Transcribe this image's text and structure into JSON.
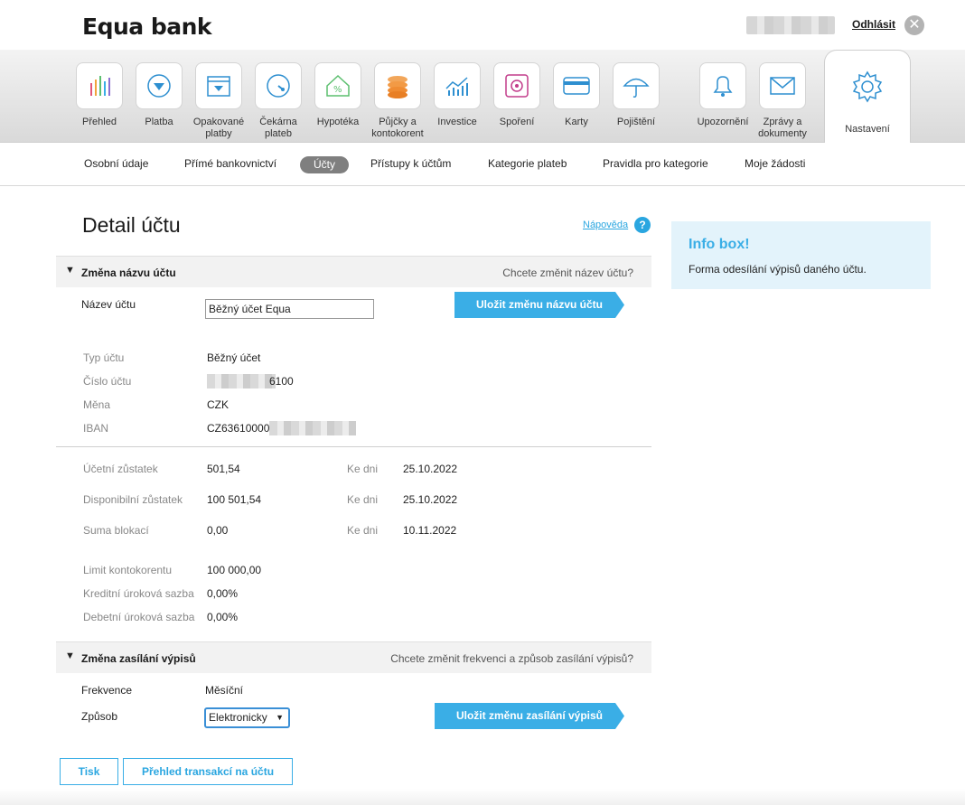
{
  "header": {
    "logo": "Equa bank",
    "logout": "Odhlásit"
  },
  "nav": {
    "items": [
      {
        "label": "Přehled",
        "icon": "chart-bars-icon"
      },
      {
        "label": "Platba",
        "icon": "payment-arrow-icon"
      },
      {
        "label": "Opakované platby",
        "icon": "calendar-icon"
      },
      {
        "label": "Čekárna plateb",
        "icon": "clock-icon"
      },
      {
        "label": "Hypotéka",
        "icon": "house-percent-icon"
      },
      {
        "label": "Půjčky a kontokorent",
        "icon": "coins-icon"
      },
      {
        "label": "Investice",
        "icon": "investment-chart-icon"
      },
      {
        "label": "Spoření",
        "icon": "safe-icon"
      },
      {
        "label": "Karty",
        "icon": "card-icon"
      },
      {
        "label": "Pojištění",
        "icon": "umbrella-icon"
      },
      {
        "label": "Upozornění",
        "icon": "bell-icon"
      },
      {
        "label": "Zprávy a dokumenty",
        "icon": "envelope-icon"
      },
      {
        "label": "Nastavení",
        "icon": "gear-icon",
        "active": true
      }
    ]
  },
  "subnav": {
    "items": [
      "Osobní údaje",
      "Přímé bankovnictví",
      "Účty",
      "Přístupy k účtům",
      "Kategorie plateb",
      "Pravidla pro kategorie",
      "Moje žádosti"
    ],
    "active": "Účty"
  },
  "main": {
    "title": "Detail účtu",
    "help": "Nápověda",
    "help_icon": "?",
    "rename": {
      "title": "Změna názvu účtu",
      "question": "Chcete změnit název účtu?",
      "name_label": "Název účtu",
      "name_value": "Běžný účet Equa",
      "save": "Uložit změnu názvu účtu"
    },
    "info": {
      "type_label": "Typ účtu",
      "type_value": "Běžný účet",
      "number_label": "Číslo účtu",
      "number_value": "6100",
      "currency_label": "Měna",
      "currency_value": "CZK",
      "iban_label": "IBAN",
      "iban_value": "CZ63610000"
    },
    "balances": {
      "accounting_label": "Účetní zůstatek",
      "accounting_value": "501,54",
      "accounting_date": "25.10.2022",
      "available_label": "Disponibilní zůstatek",
      "available_value": "100 501,54",
      "available_date": "25.10.2022",
      "blocked_label": "Suma blokací",
      "blocked_value": "0,00",
      "blocked_date": "10.11.2022",
      "date_label": "Ke dni"
    },
    "limits": {
      "overdraft_label": "Limit kontokorentu",
      "overdraft_value": "100 000,00",
      "credit_label": "Kreditní úroková sazba",
      "credit_value": "0,00%",
      "debit_label": "Debetní úroková sazba",
      "debit_value": "0,00%"
    },
    "statements": {
      "title": "Změna zasílání výpisů",
      "question": "Chcete změnit frekvenci a způsob zasílání výpisů?",
      "frequency_label": "Frekvence",
      "frequency_value": "Měsíční",
      "method_label": "Způsob",
      "method_value": "Elektronicky",
      "save": "Uložit změnu zasílání výpisů"
    },
    "print": "Tisk",
    "transactions": "Přehled transakcí na účtu"
  },
  "infobox": {
    "title": "Info box!",
    "text": "Forma odesílání výpisů daného účtu."
  },
  "colors": {
    "accent": "#3aaee6",
    "infobox_bg": "#e3f3fb"
  }
}
